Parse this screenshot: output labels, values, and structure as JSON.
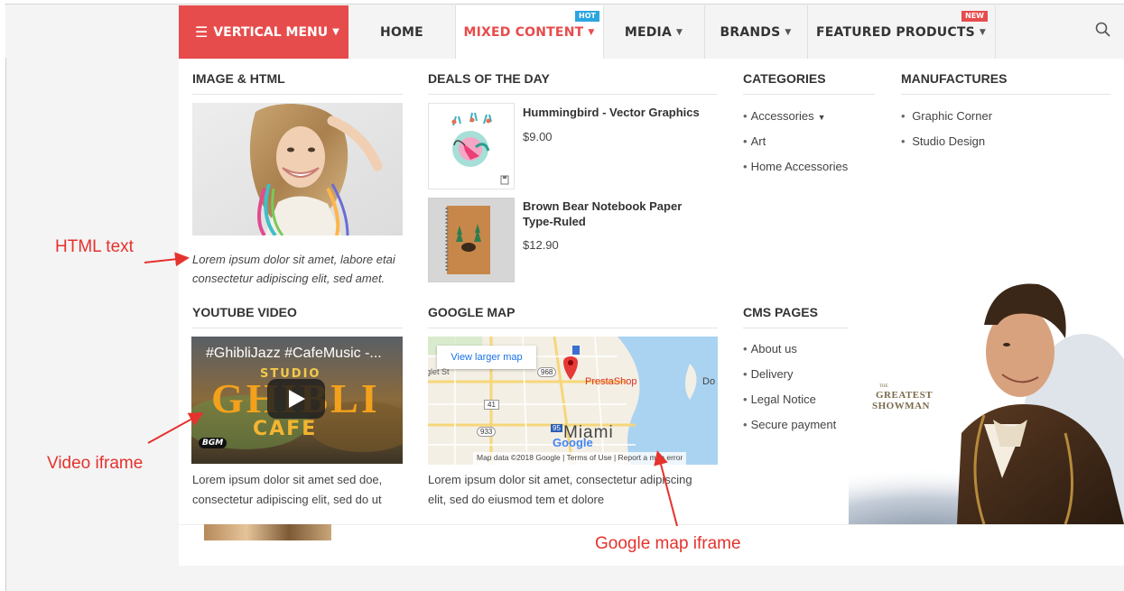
{
  "nav": {
    "vertical_menu": "VERTICAL MENU",
    "home": "HOME",
    "mixed_content": "MIXED CONTENT",
    "media": "MEDIA",
    "brands": "BRANDS",
    "featured_products": "FEATURED PRODUCTS",
    "badge_hot": "HOT",
    "badge_new": "NEW",
    "accent_color": "#e74c4c",
    "hot_color": "#2aa6e0"
  },
  "image_html": {
    "title": "IMAGE & HTML",
    "text_line1": "Lorem ipsum dolor sit amet, labore etai",
    "text_line2": "consectetur adipiscing elit, sed amet."
  },
  "deals": {
    "title": "DEALS OF THE DAY",
    "products": [
      {
        "name": "Hummingbird - Vector Graphics",
        "price": "$9.00"
      },
      {
        "name_line1": "Brown Bear Notebook Paper",
        "name_line2": "Type-Ruled",
        "price": "$12.90"
      }
    ]
  },
  "categories": {
    "title": "CATEGORIES",
    "items": [
      "Accessories",
      "Art",
      "Home Accessories"
    ]
  },
  "manufactures": {
    "title": "MANUFACTURES",
    "items": [
      "Graphic Corner",
      "Studio Design"
    ]
  },
  "youtube": {
    "title": "YOUTUBE VIDEO",
    "video_title": "#GhibliJazz #CafeMusic -...",
    "studio": "STUDIO",
    "ghibli": "GHIBLI",
    "cafe": "CAFE",
    "bgm": "BGM",
    "text_line1": "Lorem ipsum dolor sit amet sed doe,",
    "text_line2": "consectetur adipiscing elit, sed do ut"
  },
  "map": {
    "title": "GOOGLE MAP",
    "larger_map": "View larger map",
    "place": "PrestaShop",
    "city": "Miami",
    "google": "Google",
    "road_968": "968",
    "road_41": "41",
    "road_933": "933",
    "road_95": "95",
    "street": "glet St",
    "do": "Do",
    "footer": "Map data ©2018 Google  |  Terms of Use  |  Report a map error",
    "text_line1": "Lorem ipsum dolor sit amet, consectetur adipiscing",
    "text_line2": "elit, sed do eiusmod tem et dolore"
  },
  "cms": {
    "title": "CMS PAGES",
    "items": [
      "About us",
      "Delivery",
      "Legal Notice",
      "Secure payment"
    ]
  },
  "poster": {
    "line1": "THE",
    "line2": "GREATEST",
    "line3": "SHOWMAN"
  },
  "annotations": {
    "html_text": "HTML text",
    "video_iframe": "Video iframe",
    "map_iframe": "Google map iframe"
  }
}
